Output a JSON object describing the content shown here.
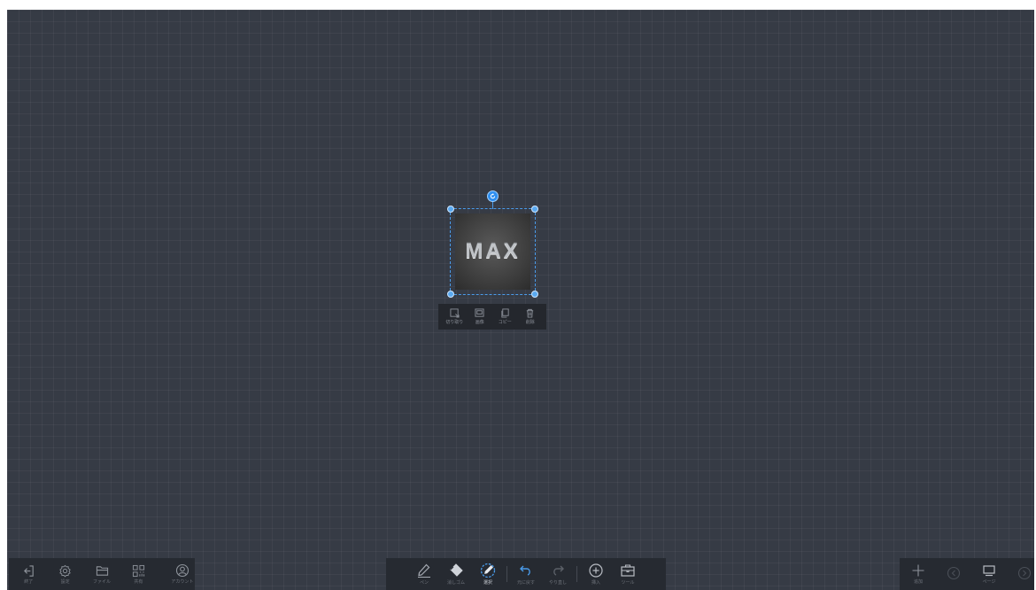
{
  "canvas": {
    "background": "#363b45",
    "grid": true
  },
  "selected_image": {
    "text": "MAX",
    "selection_color": "#4a9bea"
  },
  "context_menu": {
    "items": [
      {
        "icon": "crop-icon",
        "label": "切り取り"
      },
      {
        "icon": "image-icon",
        "label": "画像"
      },
      {
        "icon": "copy-icon",
        "label": "コピー"
      },
      {
        "icon": "trash-icon",
        "label": "削除"
      }
    ]
  },
  "left_toolbar": {
    "items": [
      {
        "icon": "exit-icon",
        "label": "終了"
      },
      {
        "icon": "settings-icon",
        "label": "設定"
      },
      {
        "icon": "folder-icon",
        "label": "ファイル"
      },
      {
        "icon": "qr-code-icon",
        "label": "共有"
      },
      {
        "icon": "user-icon",
        "label": "アカウント"
      }
    ]
  },
  "center_toolbar": {
    "items": [
      {
        "icon": "pen-icon",
        "label": "ペン"
      },
      {
        "icon": "eraser-icon",
        "label": "消しゴム"
      },
      {
        "icon": "select-icon",
        "label": "選択",
        "active": true
      },
      {
        "icon": "undo-icon",
        "label": "元に戻す"
      },
      {
        "icon": "redo-icon",
        "label": "やり直し"
      },
      {
        "icon": "insert-icon",
        "label": "挿入"
      },
      {
        "icon": "toolbox-icon",
        "label": "ツール"
      }
    ],
    "accent": "#4a9bea"
  },
  "right_toolbar": {
    "items": [
      {
        "icon": "add-page-icon",
        "label": "追加"
      },
      {
        "icon": "previous-page-icon",
        "label": ""
      },
      {
        "icon": "pages-icon",
        "label": "ページ"
      },
      {
        "icon": "next-page-icon",
        "label": ""
      }
    ]
  }
}
